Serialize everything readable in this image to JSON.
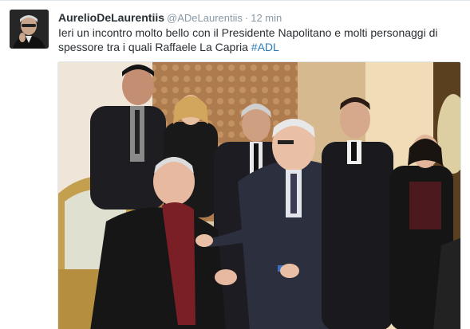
{
  "tweet": {
    "fullname": "AurelioDeLaurentiis",
    "username": "@ADeLaurentiis",
    "separator": "·",
    "time": "12 min",
    "text_before_hashtag": "Ieri un incontro molto bello con il Presidente Napolitano e molti personaggi di spessore tra i quali Raffaele La Capria ",
    "hashtag": "#ADL"
  },
  "icons": {
    "avatar": "profile-photo",
    "media": "photo-attachment"
  },
  "colors": {
    "link": "#2b7bb9",
    "muted": "#8899a6",
    "text": "#292f33"
  }
}
